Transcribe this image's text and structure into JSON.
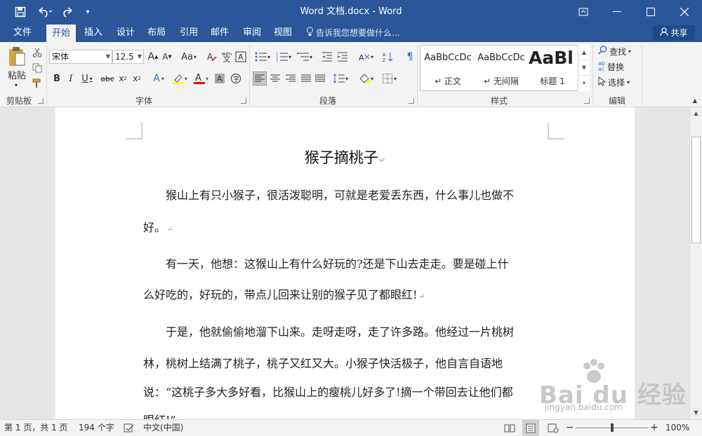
{
  "window": {
    "title": "Word 文档.docx - Word"
  },
  "tabs": {
    "items": [
      "文件",
      "开始",
      "插入",
      "设计",
      "布局",
      "引用",
      "邮件",
      "审阅",
      "视图"
    ],
    "active": "开始",
    "tell_me": "告诉我您想要做什么...",
    "share": "共享"
  },
  "ribbon": {
    "clipboard": {
      "paste_label": "粘贴",
      "group_label": "剪贴板"
    },
    "font": {
      "font_name": "宋体",
      "font_size": "12.5",
      "group_label": "字体",
      "change_case": "Aa",
      "wen": "wén\n文"
    },
    "paragraph": {
      "group_label": "段落"
    },
    "styles": {
      "group_label": "样式",
      "items": [
        {
          "sample": "AaBbCcDc",
          "name": "↵ 正文"
        },
        {
          "sample": "AaBbCcDc",
          "name": "↵ 无间隔"
        },
        {
          "sample": "AaBl",
          "name": "标题 1"
        }
      ]
    },
    "editing": {
      "group_label": "编辑",
      "find": "查找",
      "replace": "替换",
      "select": "选择"
    }
  },
  "document": {
    "title": "猴子摘桃子",
    "lines": [
      "　　猴山上有只小猴子，很活泼聪明，可就是老爱丢东西，什么事儿也做不",
      "好。",
      "　　有一天，他想：这猴山上有什么好玩的?还是下山去走走。要是碰上什",
      "么好吃的，好玩的，带点儿回来让别的猴子见了都眼红!",
      "　　于是，他就偷偷地溜下山来。走呀走呀，走了许多路。他经过一片桃树",
      "林，桃树上结满了桃子，桃子又红又大。小猴子快活极子，他自言自语地",
      "说：“这桃子多大多好看，比猴山上的瘦桃儿好多了!摘一个带回去让他们都",
      "眼红!”"
    ]
  },
  "status": {
    "page": "第 1 页，共 1 页",
    "words": "194 个字",
    "language": "中文(中国)",
    "zoom": "100%",
    "zoom_level": 1.0
  },
  "watermark": {
    "logo": "Bai du 经验",
    "url": "jingyan.baidu.com"
  },
  "colors": {
    "accent": "#2b579a",
    "ribbon_bg": "#f3f3f3",
    "highlight_yellow": "#ffff00",
    "font_color_red": "#ff0000"
  }
}
